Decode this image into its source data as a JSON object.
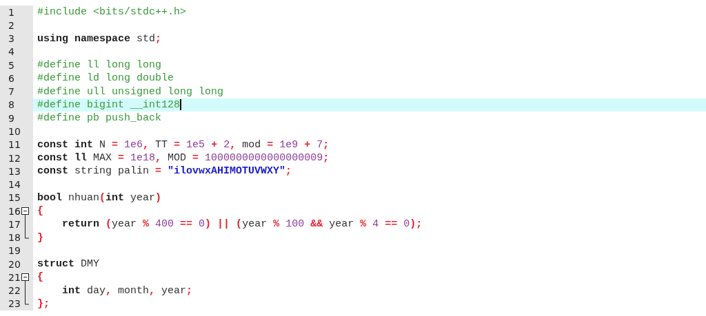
{
  "editor": {
    "lines": [
      {
        "number": "1",
        "current": false,
        "tokens": [
          {
            "kind": "pre",
            "text": "#include <bits/stdc++.h>"
          }
        ]
      },
      {
        "number": "2",
        "current": false
      },
      {
        "number": "3",
        "current": false,
        "tokens": [
          {
            "kind": "kw",
            "text": "using namespace"
          },
          {
            "kind": "id",
            "text": " std"
          },
          {
            "kind": "op",
            "text": ";"
          }
        ]
      },
      {
        "number": "4",
        "current": false
      },
      {
        "number": "5",
        "current": false,
        "tokens": [
          {
            "kind": "pre",
            "text": "#define ll long long"
          }
        ]
      },
      {
        "number": "6",
        "current": false,
        "tokens": [
          {
            "kind": "pre",
            "text": "#define ld long double"
          }
        ]
      },
      {
        "number": "7",
        "current": false,
        "tokens": [
          {
            "kind": "pre",
            "text": "#define ull unsigned long long"
          }
        ]
      },
      {
        "number": "8",
        "current": true,
        "tokens": [
          {
            "kind": "pre",
            "text": "#define bigint __int128"
          }
        ]
      },
      {
        "number": "9",
        "current": false,
        "tokens": [
          {
            "kind": "pre",
            "text": "#define pb push_back"
          }
        ]
      },
      {
        "number": "10",
        "current": false
      },
      {
        "number": "11",
        "current": false,
        "tokens": [
          {
            "kind": "kw",
            "text": "const int"
          },
          {
            "kind": "id",
            "text": " N "
          },
          {
            "kind": "op",
            "text": "="
          },
          {
            "kind": "num",
            "text": " 1e6"
          },
          {
            "kind": "op",
            "text": ","
          },
          {
            "kind": "id",
            "text": " TT "
          },
          {
            "kind": "op",
            "text": "="
          },
          {
            "kind": "num",
            "text": " 1e5 "
          },
          {
            "kind": "op",
            "text": "+"
          },
          {
            "kind": "num",
            "text": " 2"
          },
          {
            "kind": "op",
            "text": ","
          },
          {
            "kind": "id",
            "text": " mod "
          },
          {
            "kind": "op",
            "text": "="
          },
          {
            "kind": "num",
            "text": " 1e9 "
          },
          {
            "kind": "op",
            "text": "+"
          },
          {
            "kind": "num",
            "text": " 7"
          },
          {
            "kind": "op",
            "text": ";"
          }
        ]
      },
      {
        "number": "12",
        "current": false,
        "tokens": [
          {
            "kind": "kw",
            "text": "const ll"
          },
          {
            "kind": "id",
            "text": " MAX "
          },
          {
            "kind": "op",
            "text": "="
          },
          {
            "kind": "num",
            "text": " 1e18"
          },
          {
            "kind": "op",
            "text": ","
          },
          {
            "kind": "id",
            "text": " MOD "
          },
          {
            "kind": "op",
            "text": "="
          },
          {
            "kind": "num",
            "text": " 1000000000000000009"
          },
          {
            "kind": "op",
            "text": ";"
          }
        ]
      },
      {
        "number": "13",
        "current": false,
        "tokens": [
          {
            "kind": "kw",
            "text": "const"
          },
          {
            "kind": "id",
            "text": " string palin "
          },
          {
            "kind": "op",
            "text": "="
          },
          {
            "kind": "str",
            "text": " \"ilovwxAHIMOTUVWXY\""
          },
          {
            "kind": "op",
            "text": ";"
          }
        ]
      },
      {
        "number": "14",
        "current": false
      },
      {
        "number": "15",
        "current": false,
        "tokens": [
          {
            "kind": "kw",
            "text": "bool"
          },
          {
            "kind": "id",
            "text": " nhuan"
          },
          {
            "kind": "op",
            "text": "("
          },
          {
            "kind": "kw",
            "text": "int"
          },
          {
            "kind": "id",
            "text": " year"
          },
          {
            "kind": "op",
            "text": ")"
          }
        ]
      },
      {
        "number": "16",
        "kind": "opener",
        "current": false,
        "tokens": [
          {
            "kind": "op",
            "text": "{"
          }
        ]
      },
      {
        "number": "17",
        "kind": "inner",
        "current": false,
        "tokens": [
          {
            "kind": "kw",
            "text": "    return"
          },
          {
            "kind": "op",
            "text": " ("
          },
          {
            "kind": "id",
            "text": "year "
          },
          {
            "kind": "op",
            "text": "%"
          },
          {
            "kind": "num",
            "text": " 400 "
          },
          {
            "kind": "op",
            "text": "=="
          },
          {
            "kind": "num",
            "text": " 0"
          },
          {
            "kind": "op",
            "text": ") || ("
          },
          {
            "kind": "id",
            "text": "year "
          },
          {
            "kind": "op",
            "text": "%"
          },
          {
            "kind": "num",
            "text": " 100 "
          },
          {
            "kind": "op",
            "text": "&&"
          },
          {
            "kind": "id",
            "text": " year "
          },
          {
            "kind": "op",
            "text": "%"
          },
          {
            "kind": "num",
            "text": " 4 "
          },
          {
            "kind": "op",
            "text": "=="
          },
          {
            "kind": "num",
            "text": " 0"
          },
          {
            "kind": "op",
            "text": ");"
          }
        ]
      },
      {
        "number": "18",
        "kind": "closer",
        "current": false,
        "tokens": [
          {
            "kind": "op",
            "text": "}"
          }
        ]
      },
      {
        "number": "19",
        "current": false
      },
      {
        "number": "20",
        "current": false,
        "tokens": [
          {
            "kind": "kw",
            "text": "struct"
          },
          {
            "kind": "id",
            "text": " DMY"
          }
        ]
      },
      {
        "number": "21",
        "kind": "opener",
        "current": false,
        "tokens": [
          {
            "kind": "op",
            "text": "{"
          }
        ]
      },
      {
        "number": "22",
        "kind": "inner",
        "current": false,
        "tokens": [
          {
            "kind": "kw",
            "text": "    int"
          },
          {
            "kind": "id",
            "text": " day"
          },
          {
            "kind": "op",
            "text": ","
          },
          {
            "kind": "id",
            "text": " month"
          },
          {
            "kind": "op",
            "text": ","
          },
          {
            "kind": "id",
            "text": " year"
          },
          {
            "kind": "op",
            "text": ";"
          }
        ]
      },
      {
        "number": "23",
        "kind": "closer",
        "current": false,
        "tokens": [
          {
            "kind": "op",
            "text": "};"
          }
        ]
      }
    ]
  }
}
